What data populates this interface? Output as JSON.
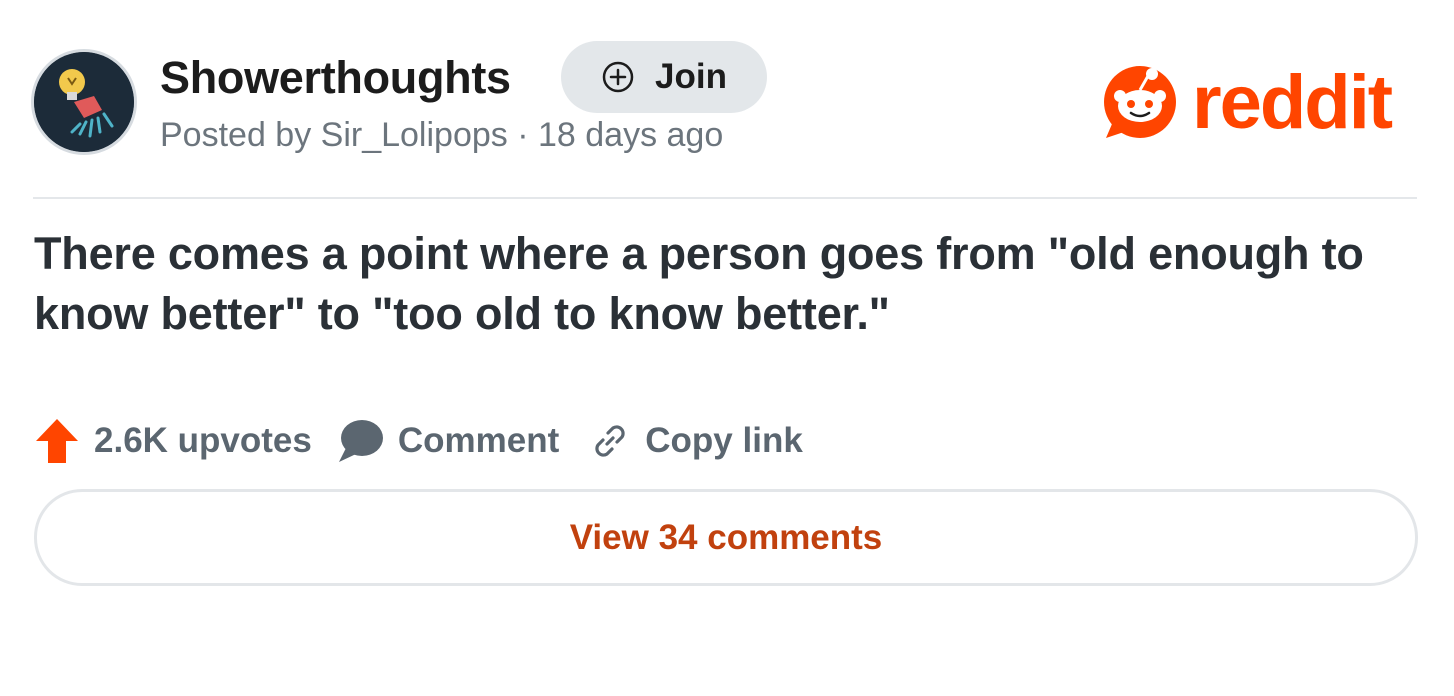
{
  "header": {
    "subreddit": "Showerthoughts",
    "join_label": "Join",
    "meta": "Posted by Sir_Lolipops · 18 days ago",
    "logo_text": "reddit",
    "avatar_icon": "showerhead-lightbulb-icon"
  },
  "post": {
    "title": "There comes a point where a person goes from \"old enough to know better\" to \"too old to know better.\""
  },
  "actions": {
    "upvotes_label": "2.6K upvotes",
    "comment_label": "Comment",
    "copy_label": "Copy link",
    "view_comments_label": "View 34 comments"
  },
  "colors": {
    "reddit_orange": "#ff4500",
    "link_orange": "#c1410e",
    "text_gray": "#5b6670"
  }
}
